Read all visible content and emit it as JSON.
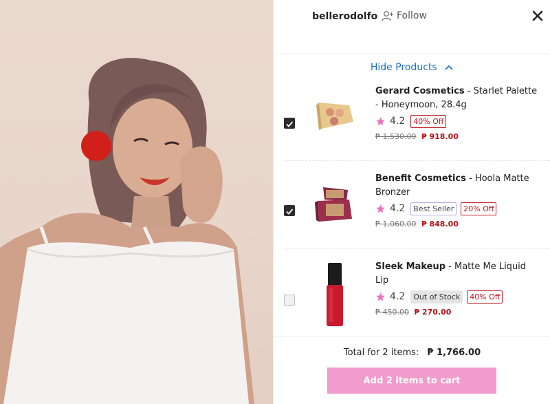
{
  "header": {
    "username": "bellerodolfo",
    "follow_label": "Follow"
  },
  "toggle": {
    "label": "Hide Products"
  },
  "products": [
    {
      "brand": "Gerard Cosmetics",
      "name": " - Starlet Palette - Honeymoon, 28.4g",
      "rating": "4.2",
      "badges": [],
      "discount": "40% Off",
      "old_price": "₱ 1,530.00",
      "price": "₱ 918.00",
      "checked": true
    },
    {
      "brand": "Benefit Cosmetics",
      "name": " - Hoola Matte Bronzer",
      "rating": "4.2",
      "badges": [
        "Best Seller"
      ],
      "discount": "20% Off",
      "old_price": "₱ 1,060.00",
      "price": "₱ 848.00",
      "checked": true
    },
    {
      "brand": "Sleek Makeup",
      "name": " - Matte Me Liquid Lip",
      "rating": "4.2",
      "badges": [
        "Out of Stock"
      ],
      "discount": "40% Off",
      "old_price": "₱ 450.00",
      "price": "₱ 270.00",
      "checked": false
    }
  ],
  "footer": {
    "total_label": "Total for 2 items:",
    "total_amount": "₱ 1,766.00",
    "cart_button": "Add 2 items to cart"
  },
  "colors": {
    "accent_pink": "#f09ccc",
    "price_red": "#b3141b",
    "link_blue": "#1a73c8"
  }
}
